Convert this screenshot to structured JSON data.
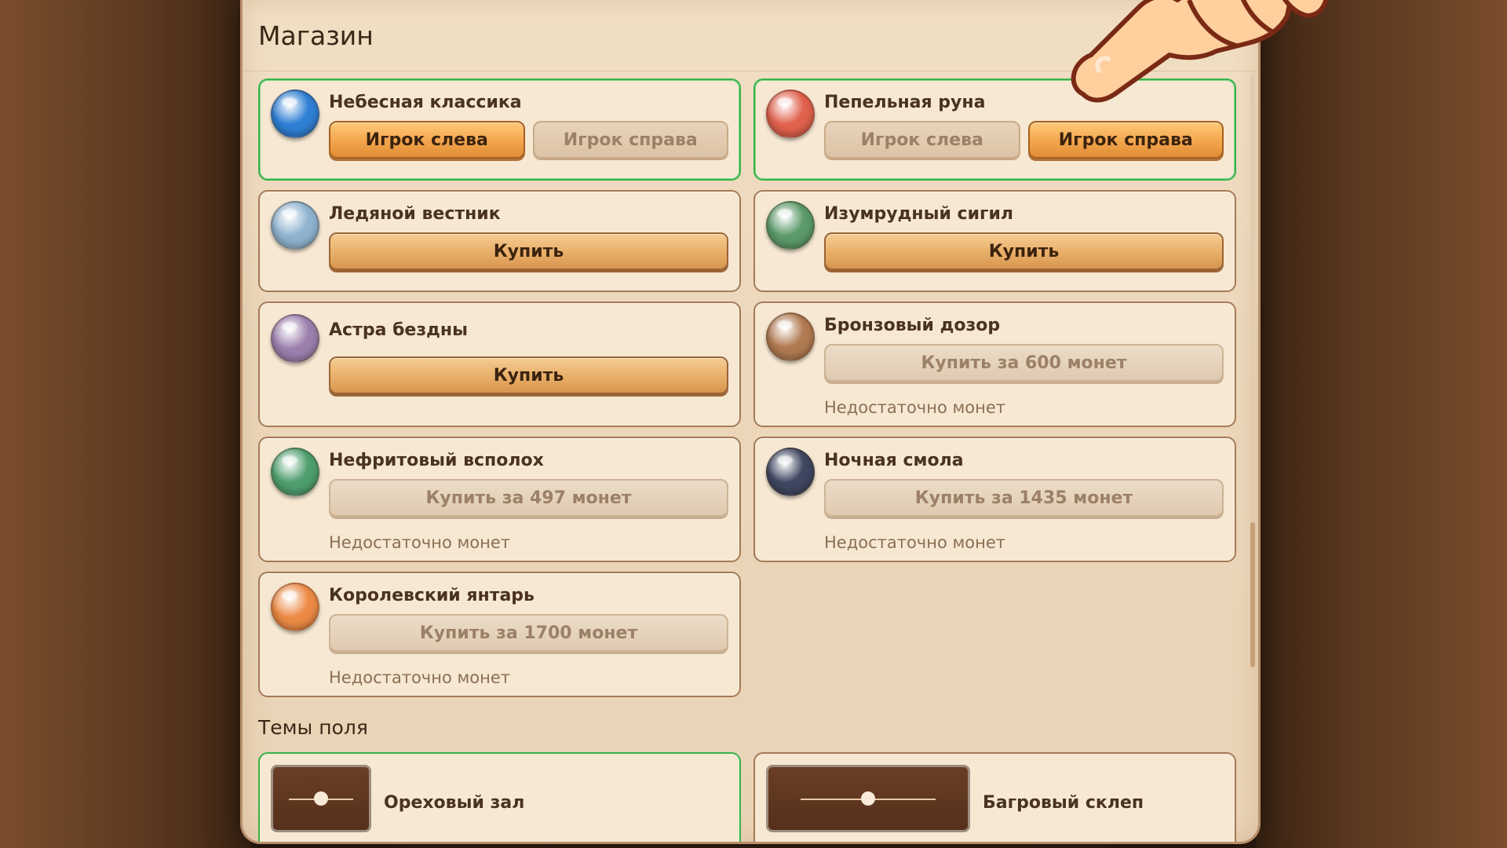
{
  "shop": {
    "title": "Магазин"
  },
  "skins": [
    {
      "name": "Небесная классика",
      "orb_color": "#2f7fd4",
      "selected": true,
      "buttons": [
        "Игрок слева",
        "Игрок справа"
      ],
      "active_button": 0
    },
    {
      "name": "Пепельная руна",
      "orb_color": "#e0614c",
      "selected": true,
      "buttons": [
        "Игрок слева",
        "Игрок справа"
      ],
      "active_button": 1
    },
    {
      "name": "Ледяной вестник",
      "orb_color": "#8fb3cf",
      "buy_label": "Купить"
    },
    {
      "name": "Изумрудный сигил",
      "orb_color": "#5c9a6a",
      "buy_label": "Купить"
    },
    {
      "name": "Астра бездны",
      "orb_color": "#9b80ad",
      "buy_label": "Купить"
    },
    {
      "name": "Бронзовый дозор",
      "orb_color": "#b07a52",
      "buy_label": "Купить за 600 монет",
      "note": "Недостаточно монет"
    },
    {
      "name": "Нефритовый всполох",
      "orb_color": "#4f9e6e",
      "buy_label": "Купить за 497 монет",
      "note": "Недостаточно монет"
    },
    {
      "name": "Ночная смола",
      "orb_color": "#3f4660",
      "buy_label": "Купить за 1435 монет",
      "note": "Недостаточно монет"
    },
    {
      "name": "Королевский янтарь",
      "orb_color": "#ec8a45",
      "buy_label": "Купить за 1700 монет",
      "note": "Недостаточно монет"
    }
  ],
  "themes": {
    "title": "Темы поля",
    "items": [
      {
        "name": "Ореховый зал",
        "selected": true
      },
      {
        "name": "Багровый склеп",
        "selected": false
      }
    ]
  }
}
